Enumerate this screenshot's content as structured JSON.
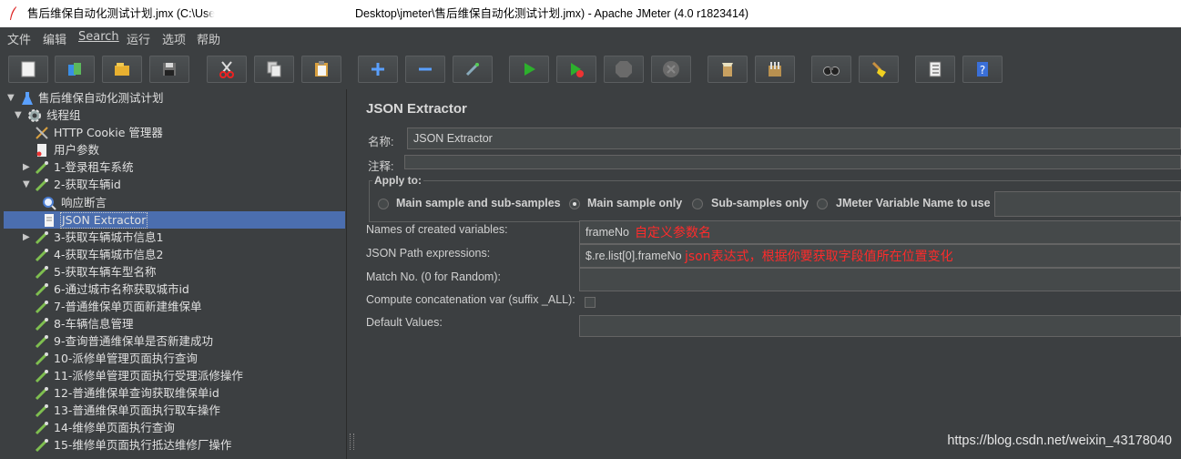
{
  "window": {
    "title_left": "售后维保自动化测试计划.jmx (C:\\User",
    "title_right": "Desktop\\jmeter\\售后维保自动化测试计划.jmx) - Apache JMeter (4.0 r1823414)"
  },
  "menu": [
    "文件",
    "编辑",
    "Search",
    "运行",
    "选项",
    "帮助"
  ],
  "toolbar": [
    {
      "icon": "new-icon"
    },
    {
      "icon": "templates-icon"
    },
    {
      "icon": "open-icon"
    },
    {
      "icon": "save-icon"
    },
    {
      "icon": "cut-icon"
    },
    {
      "icon": "copy-icon"
    },
    {
      "icon": "paste-icon"
    },
    {
      "icon": "expand-icon"
    },
    {
      "icon": "collapse-icon"
    },
    {
      "icon": "toggle-icon"
    },
    {
      "icon": "start-icon"
    },
    {
      "icon": "start-no-pauses-icon"
    },
    {
      "icon": "stop-icon"
    },
    {
      "icon": "shutdown-icon"
    },
    {
      "icon": "clear-icon"
    },
    {
      "icon": "clear-all-icon"
    },
    {
      "icon": "search-icon"
    },
    {
      "icon": "reset-search-icon"
    },
    {
      "icon": "function-helper-icon"
    },
    {
      "icon": "help-icon"
    }
  ],
  "tree": {
    "root": "售后维保自动化测试计划",
    "thread_group": "线程组",
    "items": [
      {
        "label": "HTTP Cookie 管理器"
      },
      {
        "label": "用户参数"
      },
      {
        "label": "1-登录租车系统"
      },
      {
        "label": "2-获取车辆id"
      },
      {
        "label": "响应断言"
      },
      {
        "label": "JSON Extractor"
      },
      {
        "label": "3-获取车辆城市信息1"
      },
      {
        "label": "4-获取车辆城市信息2"
      },
      {
        "label": "5-获取车辆车型名称"
      },
      {
        "label": "6-通过城市名称获取城市id"
      },
      {
        "label": "7-普通维保单页面新建维保单"
      },
      {
        "label": "8-车辆信息管理"
      },
      {
        "label": "9-查询普通维保单是否新建成功"
      },
      {
        "label": "10-派修单管理页面执行查询"
      },
      {
        "label": "11-派修单管理页面执行受理派修操作"
      },
      {
        "label": "12-普通维保单查询获取维保单id"
      },
      {
        "label": "13-普通维保单页面执行取车操作"
      },
      {
        "label": "14-维修单页面执行查询"
      },
      {
        "label": "15-维修单页面执行抵达维修厂操作"
      }
    ]
  },
  "panel": {
    "title": "JSON Extractor",
    "name_label": "名称:",
    "name_value": "JSON Extractor",
    "comment_label": "注释:",
    "comment_value": "",
    "apply_to": {
      "title": "Apply to:",
      "options": [
        "Main sample and sub-samples",
        "Main sample only",
        "Sub-samples only",
        "JMeter Variable Name to use"
      ],
      "selected": "Main sample only"
    },
    "names_label": "Names of created variables:",
    "names_value": "frameNo",
    "names_annotation": "自定义参数名",
    "path_label": "JSON Path expressions:",
    "path_value": "$.re.list[0].frameNo",
    "path_annotation": "json表达式，根据你要获取字段值所在位置变化",
    "match_label": "Match No. (0 for Random):",
    "match_value": "",
    "concat_label": "Compute concatenation var (suffix _ALL):",
    "default_label": "Default Values:",
    "default_value": ""
  },
  "watermark": "https://blog.csdn.net/weixin_43178040",
  "colors": {
    "background": "#3c3f41",
    "selection": "#4b6eaf",
    "annotation": "#ff2b2b"
  }
}
